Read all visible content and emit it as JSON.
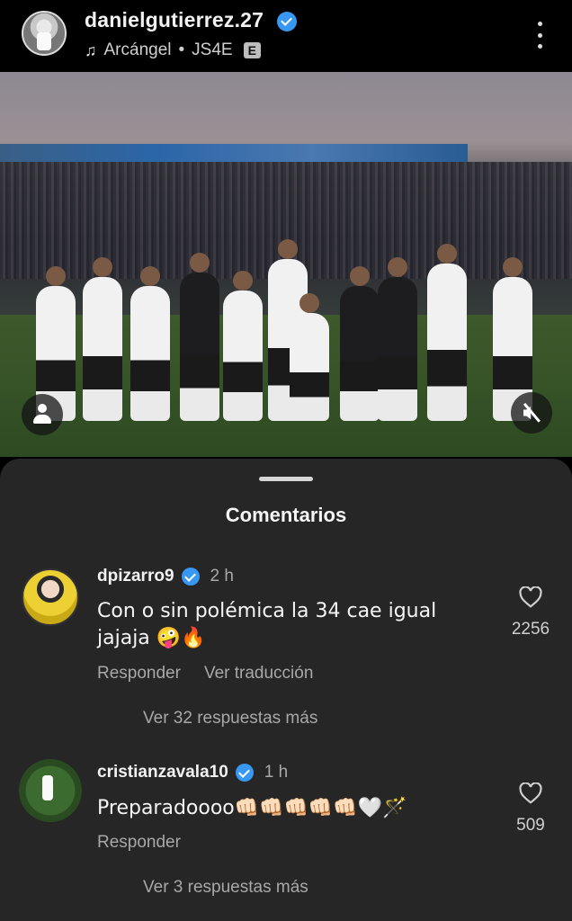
{
  "header": {
    "username": "danielgutierrez.27",
    "music_title": "Arcángel",
    "music_sep": "•",
    "music_artist": "JS4E",
    "explicit_label": "E"
  },
  "comments_sheet": {
    "title": "Comentarios",
    "comments": [
      {
        "username": "dpizarro9",
        "time": "2 h",
        "text": "Con o sin polémica la 34 cae igual jajaja 🤪🔥",
        "like_count": "2256",
        "reply_label": "Responder",
        "translate_label": "Ver traducción",
        "more_replies": "Ver 32 respuestas más"
      },
      {
        "username": "cristianzavala10",
        "time": "1 h",
        "text": "Preparadoooo👊🏻👊🏻👊🏻👊🏻👊🏻🤍🪄",
        "like_count": "509",
        "reply_label": "Responder",
        "more_replies": "Ver 3 respuestas más"
      }
    ]
  },
  "icons": {
    "music": "music-note-icon",
    "verified": "verified-badge-icon",
    "more": "more-vertical-icon",
    "tag": "person-tag-icon",
    "mute": "volume-muted-icon",
    "like": "heart-icon"
  }
}
